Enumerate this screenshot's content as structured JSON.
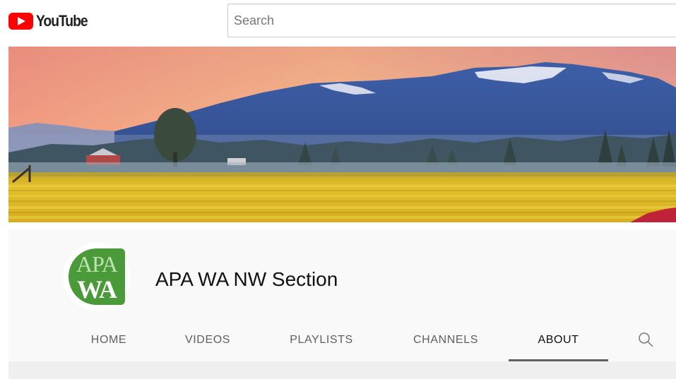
{
  "brand": {
    "name": "YouTube",
    "logo_icon": "youtube-play-icon",
    "logo_red": "#ff0000"
  },
  "search": {
    "placeholder": "Search",
    "value": ""
  },
  "channel": {
    "name": "APA WA NW Section",
    "avatar_line1": "APA",
    "avatar_line2": "WA",
    "avatar_color": "#4a9a3a"
  },
  "tabs": [
    {
      "label": "HOME",
      "active": false
    },
    {
      "label": "VIDEOS",
      "active": false
    },
    {
      "label": "PLAYLISTS",
      "active": false
    },
    {
      "label": "CHANNELS",
      "active": false
    },
    {
      "label": "ABOUT",
      "active": true
    }
  ],
  "tab_search_icon": "search-icon"
}
